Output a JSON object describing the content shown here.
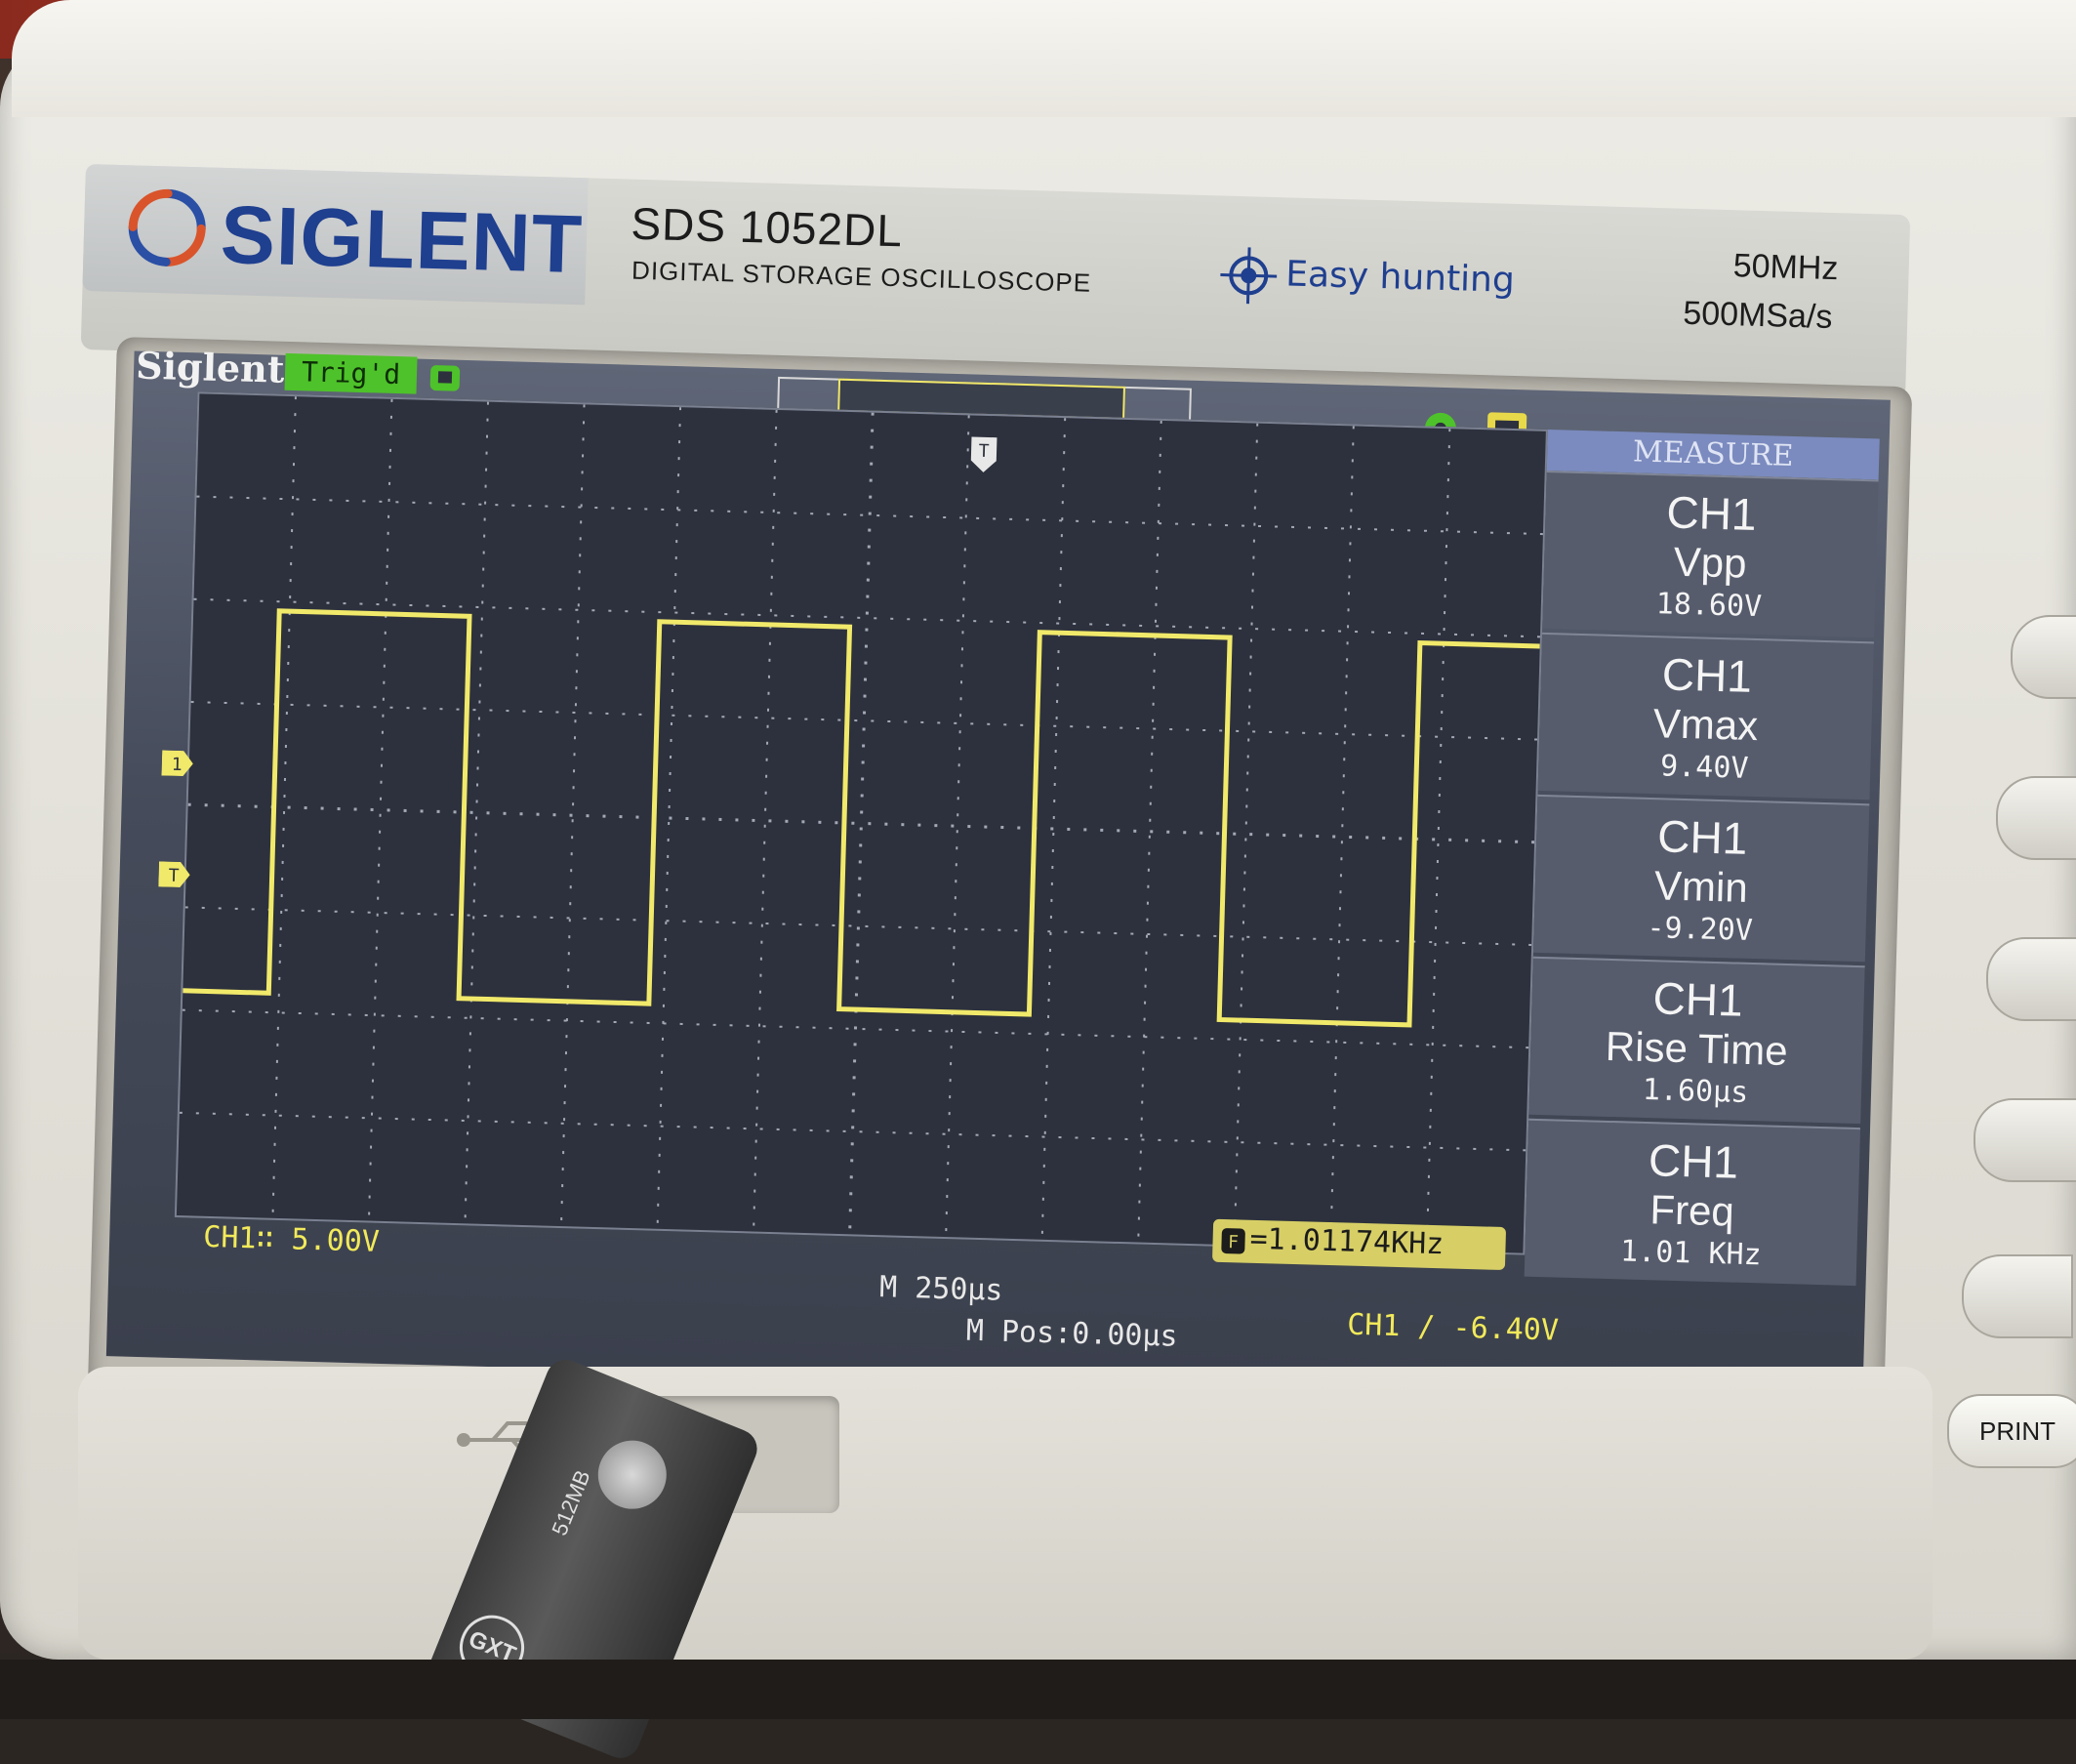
{
  "nameplate": {
    "brand": "SIGLENT",
    "model": "SDS 1052DL",
    "description": "DIGITAL STORAGE OSCILLOSCOPE",
    "feature": "Easy hunting",
    "bandwidth": "50MHz",
    "sample_rate": "500MSa/s"
  },
  "screen": {
    "top_label": "Siglent",
    "trigger_status": "Trig'd",
    "measure_title": "MEASURE",
    "ch1_marker": "1",
    "trigger_marker": "T",
    "ch1_scale": "CH1∷ 5.00V",
    "frequency_counter": "=1.01174KHz",
    "timebase": "M 250μs",
    "m_pos": "M Pos:0.00μs",
    "trigger": "CH1 ∕ -6.40V"
  },
  "measurements": [
    {
      "channel": "CH1",
      "name": "Vpp",
      "value": "18.60V"
    },
    {
      "channel": "CH1",
      "name": "Vmax",
      "value": "9.40V"
    },
    {
      "channel": "CH1",
      "name": "Vmin",
      "value": "-9.20V"
    },
    {
      "channel": "CH1",
      "name": "Rise Time",
      "value": "1.60μs"
    },
    {
      "channel": "CH1",
      "name": "Freq",
      "value": "1.01 KHz"
    }
  ],
  "waveform": {
    "type": "square",
    "high_v": 9.4,
    "low_v": -9.2,
    "volts_per_div": 5,
    "time_per_div_us": 250,
    "frequency_khz": 1.01174
  },
  "panel": {
    "print_button": "PRINT",
    "usb_drive_label": "512MB",
    "usb_drive_brand": "GXT"
  },
  "colors": {
    "trace": "#f1e96a",
    "brand_blue": "#1f3f8f",
    "trig_green": "#4ec22a"
  }
}
